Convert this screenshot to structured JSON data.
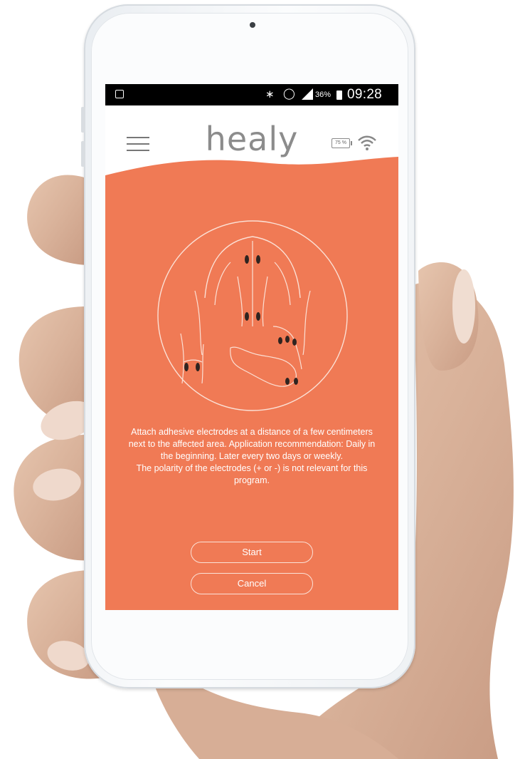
{
  "status_bar": {
    "battery_percent": "36%",
    "time": "09:28",
    "icons": [
      "notification-icon",
      "bluetooth-icon",
      "alarm-icon",
      "signal-icon",
      "battery-icon"
    ]
  },
  "app_bar": {
    "logo": "healy",
    "device_battery": "75 %",
    "icons": [
      "menu-icon",
      "device-battery-icon",
      "wifi-icon"
    ]
  },
  "illustration": {
    "subject": "electrode placement on back, elbow and knee"
  },
  "instructions": {
    "line1": "Attach adhesive electrodes at a distance of a few centimeters next to the affected area. Application recommendation: Daily in the beginning. Later every two days or weekly.",
    "line2": "The polarity of the electrodes (+ or -) is not relevant for this program."
  },
  "buttons": {
    "start": "Start",
    "cancel": "Cancel"
  },
  "colors": {
    "accent": "#f07a55",
    "header": "#ffffff",
    "logo": "#8c8c8c"
  }
}
